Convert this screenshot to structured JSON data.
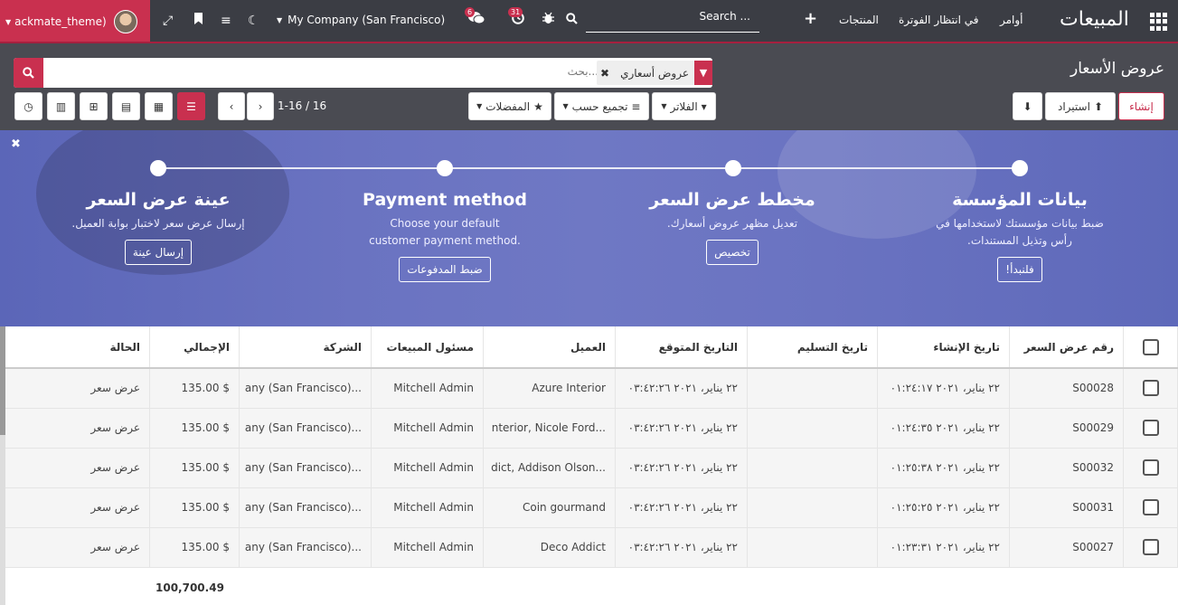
{
  "navbar": {
    "user": "ackmate_theme)",
    "company": "My Company (San Francisco)",
    "search_placeholder": "Search ...",
    "messages_badge": "6",
    "activities_badge": "31",
    "menu": [
      "المنتجات",
      "في انتظار الفوترة",
      "أوامر"
    ],
    "app_title": "المبيعات"
  },
  "control": {
    "title": "عروض الأسعار",
    "facet_label": "عروض أسعاري",
    "search_placeholder": "بحث...",
    "create_label": "إنشاء",
    "import_label": "استيراد",
    "filters_label": "الفلاتر",
    "groupby_label": "تجميع حسب",
    "favorites_label": "المفضلات",
    "pager": "1-16 / 16"
  },
  "banner": {
    "steps": [
      {
        "title": "بيانات المؤسسة",
        "desc": "ضبط بيانات مؤسستك لاستخدامها في رأس وتذيل المستندات.",
        "button": "فلنبدأ!"
      },
      {
        "title": "مخطط عرض السعر",
        "desc": "تعديل مظهر عروض أسعارك.",
        "button": "تخصيص"
      },
      {
        "title": "Payment method",
        "desc": "Choose your default customer payment method.",
        "button": "ضبط المدفوعات"
      },
      {
        "title": "عينة عرض السعر",
        "desc": "إرسال عرض سعر لاختبار بوابة العميل.",
        "button": "إرسال عينة"
      }
    ]
  },
  "table": {
    "headers": [
      "رقم عرض السعر",
      "تاريخ الإنشاء",
      "تاريخ التسليم",
      "التاريخ المتوقع",
      "العميل",
      "مسئول المبيعات",
      "الشركة",
      "الإجمالي",
      "الحالة"
    ],
    "rows": [
      {
        "number": "S00028",
        "created": "٢٢ يناير، ٢٠٢١ ٠١:٢٤:١٧",
        "delivery": "",
        "expected": "٢٢ يناير، ٢٠٢١ ٠٣:٤٢:٢٦",
        "customer": "Azure Interior",
        "salesperson": "Mitchell Admin",
        "company": "...any (San Francisco)",
        "total": "$ 135.00",
        "status": "عرض سعر"
      },
      {
        "number": "S00029",
        "created": "٢٢ يناير، ٢٠٢١ ٠١:٢٤:٣٥",
        "delivery": "",
        "expected": "٢٢ يناير، ٢٠٢١ ٠٣:٤٢:٢٦",
        "customer": "...nterior, Nicole Ford",
        "salesperson": "Mitchell Admin",
        "company": "...any (San Francisco)",
        "total": "$ 135.00",
        "status": "عرض سعر"
      },
      {
        "number": "S00032",
        "created": "٢٢ يناير، ٢٠٢١ ٠١:٢٥:٣٨",
        "delivery": "",
        "expected": "٢٢ يناير، ٢٠٢١ ٠٣:٤٢:٢٦",
        "customer": "...dict, Addison Olson",
        "salesperson": "Mitchell Admin",
        "company": "...any (San Francisco)",
        "total": "$ 135.00",
        "status": "عرض سعر"
      },
      {
        "number": "S00031",
        "created": "٢٢ يناير، ٢٠٢١ ٠١:٢٥:٢٥",
        "delivery": "",
        "expected": "٢٢ يناير، ٢٠٢١ ٠٣:٤٢:٢٦",
        "customer": "Coin gourmand",
        "salesperson": "Mitchell Admin",
        "company": "...any (San Francisco)",
        "total": "$ 135.00",
        "status": "عرض سعر"
      },
      {
        "number": "S00027",
        "created": "٢٢ يناير، ٢٠٢١ ٠١:٢٣:٣١",
        "delivery": "",
        "expected": "٢٢ يناير، ٢٠٢١ ٠٣:٤٢:٢٦",
        "customer": "Deco Addict",
        "salesperson": "Mitchell Admin",
        "company": "...any (San Francisco)",
        "total": "$ 135.00",
        "status": "عرض سعر"
      }
    ],
    "grand_total": "100,700.49"
  },
  "colors": {
    "brand": "#c9304f",
    "navbar": "#3b3d44",
    "banner": "#6a73c1"
  }
}
